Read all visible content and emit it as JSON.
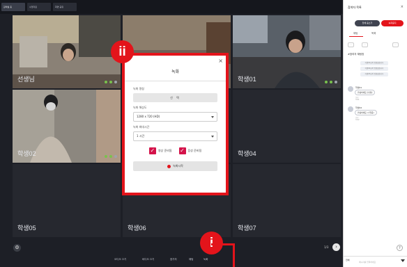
{
  "tabs": [
    {
      "label": "강의실 홈"
    },
    {
      "label": "수업자료"
    },
    {
      "label": "화면 공유"
    }
  ],
  "participants": [
    {
      "name": "선생님"
    },
    {
      "name": ""
    },
    {
      "name": "학생01"
    },
    {
      "name": "학생02"
    },
    {
      "name": ""
    },
    {
      "name": "학생04"
    },
    {
      "name": "학생05"
    },
    {
      "name": "학생06"
    },
    {
      "name": "학생07"
    }
  ],
  "modal": {
    "title": "녹화",
    "close": "×",
    "name_label": "녹화 명칭",
    "select_label": "선  택",
    "resolution_label": "녹화 해상도",
    "resolution_value": "1280 x 720 (HD)",
    "max_time_label": "녹화 최대시간",
    "max_time_value": "1 시간",
    "check1_label": "영상 준비됨",
    "check2_label": "음성 준비됨",
    "start_label": "녹화시작"
  },
  "markers": {
    "top": "ii",
    "bottom": "i"
  },
  "toolbar": {
    "items": [
      "오디오 끄기",
      "비디오 끄기",
      "참가자",
      "채팅",
      "녹화"
    ],
    "page": "1/3"
  },
  "panel": {
    "title": "참여자 목록",
    "close": "×",
    "btn_mute": "전체 음소거",
    "btn_record": "녹화중지",
    "tab_chat": "채팅",
    "tab_list": "목록",
    "section": "#참여자 채팅방",
    "system_msgs": [
      "학생01님이 입장했습니다",
      "학생02님이 입장했습니다",
      "학생03님이 입장했습니다"
    ],
    "chats": [
      {
        "who": "학생01",
        "msg": "안녕하세요 선생님",
        "time": "오후 3:01"
      },
      {
        "who": "학생02",
        "msg": "안녕하세요 (수업중)",
        "time": "오후 3:02"
      }
    ],
    "input_target": "전체",
    "input_placeholder": "메시지를 입력하세요"
  },
  "colors": {
    "accent": "#e3141b",
    "check": "#d4134a",
    "background": "#1d1f26"
  }
}
